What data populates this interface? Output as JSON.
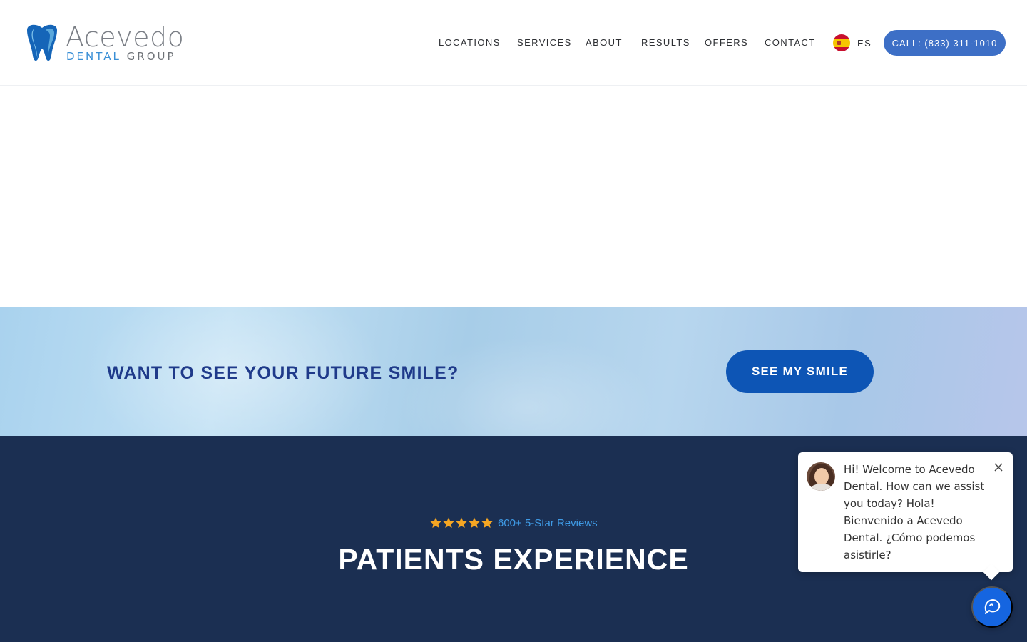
{
  "brand": {
    "name": "Acevedo",
    "sub_dental": "DENTAL",
    "sub_group": "GROUP"
  },
  "nav": {
    "items": [
      "LOCATIONS",
      "SERVICES",
      "ABOUT",
      "RESULTS",
      "OFFERS",
      "CONTACT"
    ],
    "language": "ES",
    "call_label": "CALL: (833) 311-1010"
  },
  "smile_banner": {
    "title": "WANT TO SEE YOUR FUTURE SMILE?",
    "button_label": "SEE MY SMILE"
  },
  "reviews": {
    "stars": 5,
    "count_label": "600+ 5-Star Reviews",
    "title": "PATIENTS EXPERIENCE"
  },
  "chat": {
    "message": "Hi! Welcome to Acevedo Dental. How can we assist you today? Hola! Bienvenido a Acevedo Dental. ¿Cómo podemos asistirle?",
    "close_icon": "close-icon",
    "launcher_icon": "chat-bubble-icon"
  },
  "colors": {
    "accent_blue": "#3d6fc6",
    "cta_blue": "#0d55b5",
    "navy": "#1b2f52",
    "banner_title": "#1f3a8a",
    "star_gold": "#f5a623",
    "reviews_link": "#3f9be6",
    "chat_launcher": "#1565e0"
  }
}
